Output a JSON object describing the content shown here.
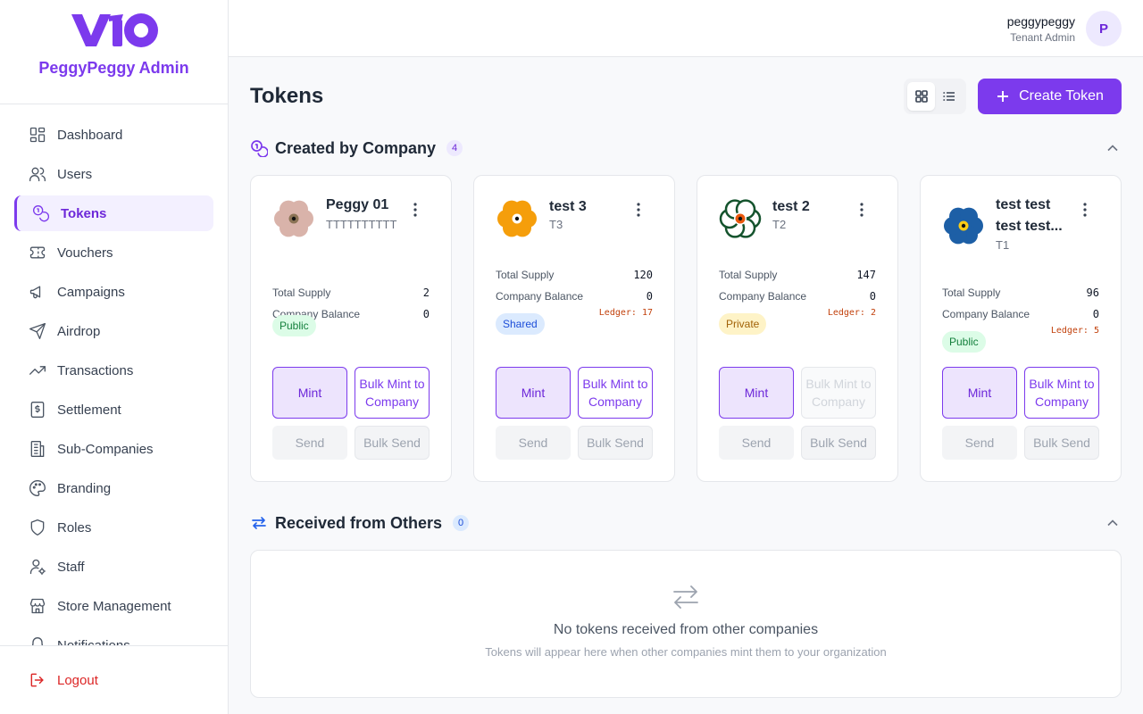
{
  "brand": {
    "logo_text": "VIO",
    "name": "PeggyPeggy Admin"
  },
  "sidebar": {
    "items": [
      {
        "label": "Dashboard",
        "icon": "dashboard-icon",
        "active": false
      },
      {
        "label": "Users",
        "icon": "users-icon",
        "active": false
      },
      {
        "label": "Tokens",
        "icon": "tokens-icon",
        "active": true
      },
      {
        "label": "Vouchers",
        "icon": "ticket-icon",
        "active": false
      },
      {
        "label": "Campaigns",
        "icon": "megaphone-icon",
        "active": false
      },
      {
        "label": "Airdrop",
        "icon": "send-icon",
        "active": false
      },
      {
        "label": "Transactions",
        "icon": "trending-up-icon",
        "active": false
      },
      {
        "label": "Settlement",
        "icon": "receipt-icon",
        "active": false
      },
      {
        "label": "Sub-Companies",
        "icon": "building-icon",
        "active": false
      },
      {
        "label": "Branding",
        "icon": "palette-icon",
        "active": false
      },
      {
        "label": "Roles",
        "icon": "shield-icon",
        "active": false
      },
      {
        "label": "Staff",
        "icon": "user-gear-icon",
        "active": false
      },
      {
        "label": "Store Management",
        "icon": "store-icon",
        "active": false
      },
      {
        "label": "Notifications",
        "icon": "bell-icon",
        "active": false
      }
    ],
    "logout_label": "Logout"
  },
  "topbar": {
    "user_name": "peggypeggy",
    "user_role": "Tenant Admin",
    "avatar_initial": "P"
  },
  "page": {
    "title": "Tokens",
    "create_label": "Create Token"
  },
  "created_section": {
    "title": "Created by Company",
    "count": "4"
  },
  "tokens": [
    {
      "name": "Peggy 01",
      "symbol": "TTTTTTTTTT",
      "total_supply_label": "Total Supply",
      "total_supply": "2",
      "balance_label": "Company Balance",
      "balance": "0",
      "ledger": "",
      "visibility": "Public",
      "visibility_class": "public",
      "mint_label": "Mint",
      "bulk_mint_label": "Bulk Mint to Company",
      "bulk_mint_disabled": false,
      "send_label": "Send",
      "bulk_send_label": "Bulk Send",
      "flower_color": "#d9b3aa",
      "center_color": "#8b7355"
    },
    {
      "name": "test 3",
      "symbol": "T3",
      "total_supply_label": "Total Supply",
      "total_supply": "120",
      "balance_label": "Company Balance",
      "balance": "0",
      "ledger": "Ledger: 17",
      "visibility": "Shared",
      "visibility_class": "shared",
      "mint_label": "Mint",
      "bulk_mint_label": "Bulk Mint to Company",
      "bulk_mint_disabled": false,
      "send_label": "Send",
      "bulk_send_label": "Bulk Send",
      "flower_color": "#f59e0b",
      "center_color": "#ffffff"
    },
    {
      "name": "test 2",
      "symbol": "T2",
      "total_supply_label": "Total Supply",
      "total_supply": "147",
      "balance_label": "Company Balance",
      "balance": "0",
      "ledger": "Ledger: 2",
      "visibility": "Private",
      "visibility_class": "private",
      "mint_label": "Mint",
      "bulk_mint_label": "Bulk Mint to Company",
      "bulk_mint_disabled": true,
      "send_label": "Send",
      "bulk_send_label": "Bulk Send",
      "flower_color": "#ffffff",
      "center_color": "#ea580c"
    },
    {
      "name": "test test test test...",
      "symbol": "T1",
      "total_supply_label": "Total Supply",
      "total_supply": "96",
      "balance_label": "Company Balance",
      "balance": "0",
      "ledger": "Ledger: 5",
      "visibility": "Public",
      "visibility_class": "public",
      "mint_label": "Mint",
      "bulk_mint_label": "Bulk Mint to Company",
      "bulk_mint_disabled": false,
      "send_label": "Send",
      "bulk_send_label": "Bulk Send",
      "flower_color": "#1d5fa6",
      "center_color": "#facc15"
    }
  ],
  "received_section": {
    "title": "Received from Others",
    "count": "0",
    "empty_title": "No tokens received from other companies",
    "empty_subtitle": "Tokens will appear here when other companies mint them to your organization"
  }
}
